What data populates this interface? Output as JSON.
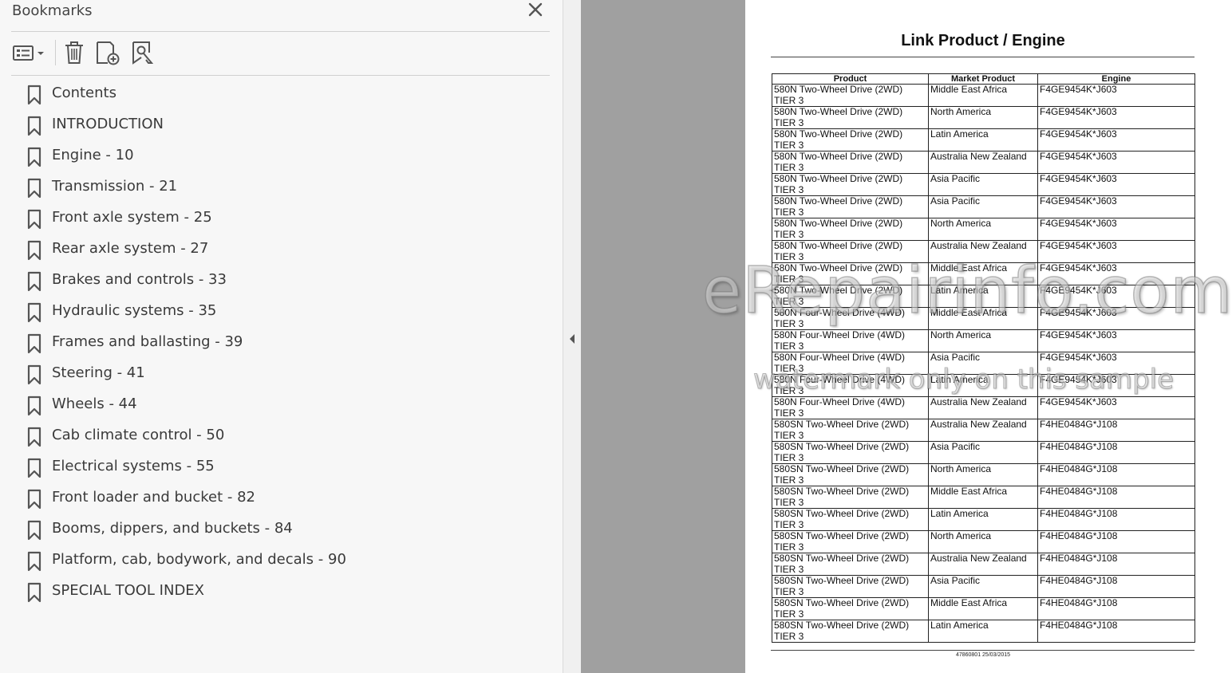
{
  "panel": {
    "title": "Bookmarks",
    "icons": {
      "close": "close-icon",
      "options": "list-options-icon",
      "delete": "trash-icon",
      "add": "add-bookmark-icon",
      "new_from_selection": "bookmark-search-icon"
    },
    "bookmarks": [
      "Contents",
      "INTRODUCTION",
      "Engine - 10",
      "Transmission - 21",
      "Front axle system - 25",
      "Rear axle system - 27",
      "Brakes and controls - 33",
      "Hydraulic systems - 35",
      "Frames and ballasting - 39",
      "Steering - 41",
      "Wheels - 44",
      "Cab climate control - 50",
      "Electrical systems - 55",
      "Front loader and bucket - 82",
      "Booms, dippers, and buckets - 84",
      "Platform, cab, bodywork, and decals - 90",
      "SPECIAL TOOL INDEX"
    ]
  },
  "document": {
    "title": "Link Product / Engine",
    "headers": [
      "Product",
      "Market Product",
      "Engine"
    ],
    "rows": [
      [
        "580N Two-Wheel Drive (2WD) TIER 3",
        "Middle East Africa",
        "F4GE9454K*J603"
      ],
      [
        "580N Two-Wheel Drive (2WD) TIER 3",
        "North America",
        "F4GE9454K*J603"
      ],
      [
        "580N Two-Wheel Drive (2WD) TIER 3",
        "Latin America",
        "F4GE9454K*J603"
      ],
      [
        "580N Two-Wheel Drive (2WD) TIER 3",
        "Australia New Zealand",
        "F4GE9454K*J603"
      ],
      [
        "580N Two-Wheel Drive (2WD) TIER 3",
        "Asia Pacific",
        "F4GE9454K*J603"
      ],
      [
        "580N Two-Wheel Drive (2WD) TIER 3",
        "Asia Pacific",
        "F4GE9454K*J603"
      ],
      [
        "580N Two-Wheel Drive (2WD) TIER 3",
        "North America",
        "F4GE9454K*J603"
      ],
      [
        "580N Two-Wheel Drive (2WD) TIER 3",
        "Australia New Zealand",
        "F4GE9454K*J603"
      ],
      [
        "580N Two-Wheel Drive (2WD) TIER 3",
        "Middle East Africa",
        "F4GE9454K*J603"
      ],
      [
        "580N Two-Wheel Drive (2WD) TIER 3",
        "Latin America",
        "F4GE9454K*J603"
      ],
      [
        "580N Four-Wheel Drive (4WD) TIER 3",
        "Middle East Africa",
        "F4GE9454K*J603"
      ],
      [
        "580N Four-Wheel Drive (4WD) TIER 3",
        "North America",
        "F4GE9454K*J603"
      ],
      [
        "580N Four-Wheel Drive (4WD) TIER 3",
        "Asia Pacific",
        "F4GE9454K*J603"
      ],
      [
        "580N Four-Wheel Drive (4WD) TIER 3",
        "Latin America",
        "F4GE9454K*J603"
      ],
      [
        "580N Four-Wheel Drive (4WD) TIER 3",
        "Australia New Zealand",
        "F4GE9454K*J603"
      ],
      [
        "580SN Two-Wheel Drive (2WD) TIER 3",
        "Australia New Zealand",
        "F4HE0484G*J108"
      ],
      [
        "580SN Two-Wheel Drive (2WD) TIER 3",
        "Asia Pacific",
        "F4HE0484G*J108"
      ],
      [
        "580SN Two-Wheel Drive (2WD) TIER 3",
        "North America",
        "F4HE0484G*J108"
      ],
      [
        "580SN Two-Wheel Drive (2WD) TIER 3",
        "Middle East Africa",
        "F4HE0484G*J108"
      ],
      [
        "580SN Two-Wheel Drive (2WD) TIER 3",
        "Latin America",
        "F4HE0484G*J108"
      ],
      [
        "580SN Two-Wheel Drive (2WD) TIER 3",
        "North America",
        "F4HE0484G*J108"
      ],
      [
        "580SN Two-Wheel Drive (2WD) TIER 3",
        "Australia New Zealand",
        "F4HE0484G*J108"
      ],
      [
        "580SN Two-Wheel Drive (2WD) TIER 3",
        "Asia Pacific",
        "F4HE0484G*J108"
      ],
      [
        "580SN Two-Wheel Drive (2WD) TIER 3",
        "Middle East Africa",
        "F4HE0484G*J108"
      ],
      [
        "580SN Two-Wheel Drive (2WD) TIER 3",
        "Latin America",
        "F4HE0484G*J108"
      ]
    ],
    "footer": "47860801 25/03/2015"
  },
  "watermark": {
    "main": "eRepairinfo.com",
    "sub": "watermark only on this sample"
  }
}
